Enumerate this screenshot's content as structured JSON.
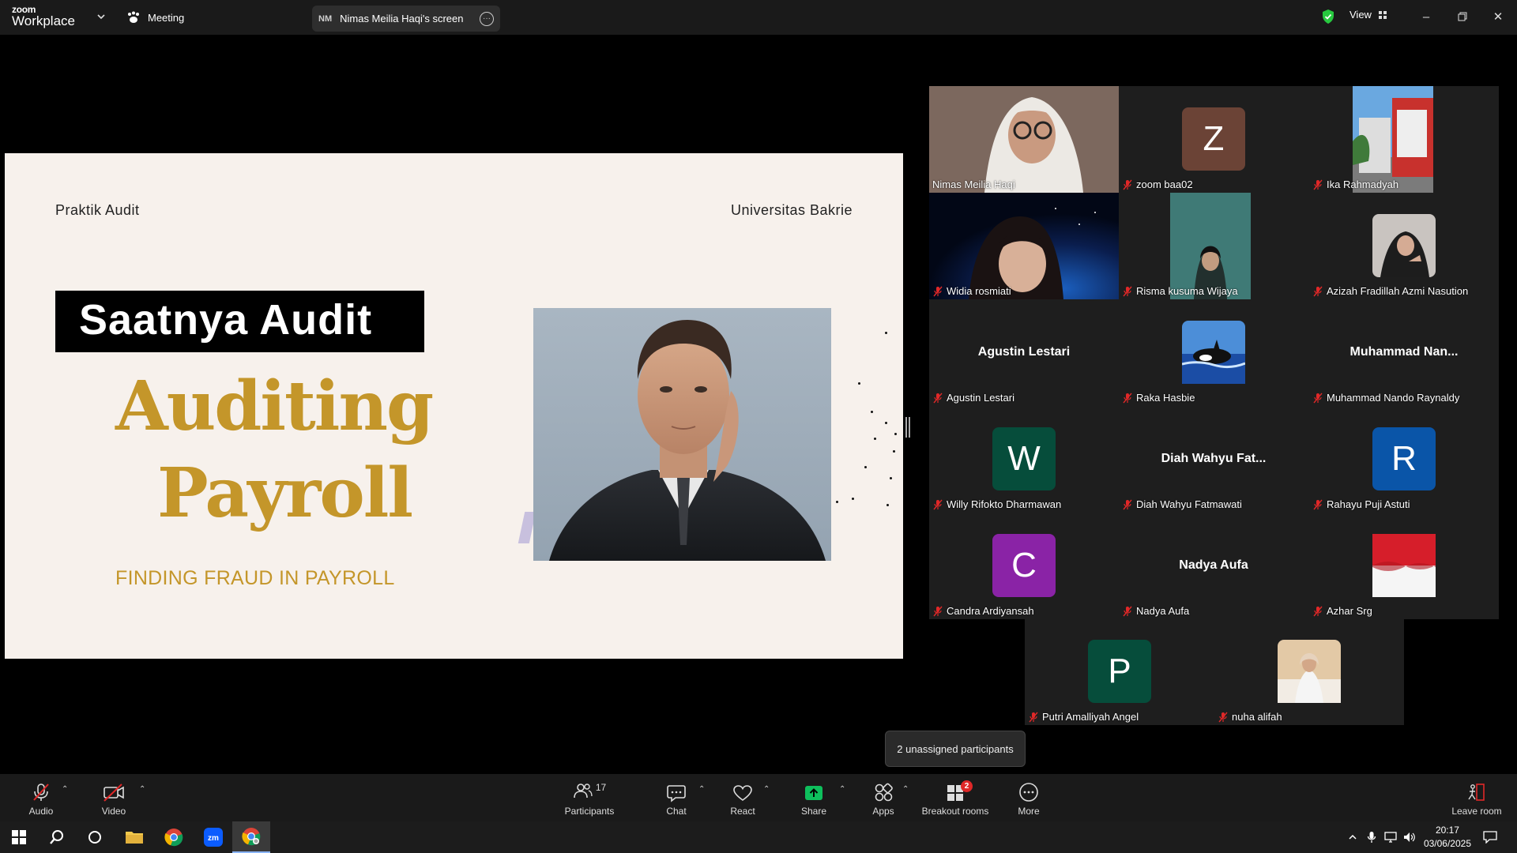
{
  "app": {
    "logo_top": "zoom",
    "logo_bottom": "Workplace",
    "meeting_label": "Meeting",
    "screen_initials": "NM",
    "screen_title": "Nimas Meilia Haqi's screen",
    "view_label": "View"
  },
  "slide": {
    "header_left": "Praktik Audit",
    "header_right": "Universitas Bakrie",
    "banner": "Saatnya Audit",
    "title_line1": "Auditing",
    "title_line2": "Payroll",
    "subtitle": "FINDING FRAUD IN PAYROLL"
  },
  "participants": [
    {
      "name": "Nimas Meilia Haqi",
      "display": "",
      "initial": "",
      "muted": false,
      "kind": "video-hijab",
      "active": true
    },
    {
      "name": "zoom baa02",
      "display": "",
      "initial": "Z",
      "color": "#6b4336",
      "muted": true,
      "kind": "avatar"
    },
    {
      "name": "Ika Rahmadyah",
      "display": "",
      "initial": "",
      "muted": true,
      "kind": "photo-building"
    },
    {
      "name": "Widia rosmiati",
      "display": "",
      "initial": "",
      "muted": true,
      "kind": "video-space"
    },
    {
      "name": "Risma kusuma Wijaya",
      "display": "",
      "initial": "",
      "muted": true,
      "kind": "photo-forest"
    },
    {
      "name": "Azizah Fradillah Azmi Nasution",
      "display": "",
      "initial": "",
      "muted": true,
      "kind": "photo-portrait"
    },
    {
      "name": "Agustin Lestari",
      "display": "Agustin Lestari",
      "initial": "",
      "muted": true,
      "kind": "text"
    },
    {
      "name": "Raka Hasbie",
      "display": "",
      "initial": "",
      "muted": true,
      "kind": "photo-orca"
    },
    {
      "name": "Muhammad Nando Raynaldy",
      "display": "Muhammad  Nan...",
      "initial": "",
      "muted": true,
      "kind": "text"
    },
    {
      "name": "Willy Rifokto Dharmawan",
      "display": "",
      "initial": "W",
      "color": "#064d3b",
      "muted": true,
      "kind": "avatar"
    },
    {
      "name": "Diah Wahyu Fatmawati",
      "display": "Diah Wahyu Fat...",
      "initial": "",
      "muted": true,
      "kind": "text"
    },
    {
      "name": "Rahayu Puji Astuti",
      "display": "",
      "initial": "R",
      "color": "#0a55a8",
      "muted": true,
      "kind": "avatar"
    },
    {
      "name": "Candra Ardiyansah",
      "display": "",
      "initial": "C",
      "color": "#8a23a6",
      "muted": true,
      "kind": "avatar"
    },
    {
      "name": "Nadya Aufa",
      "display": "Nadya Aufa",
      "initial": "",
      "muted": true,
      "kind": "text"
    },
    {
      "name": "Azhar Srg",
      "display": "",
      "initial": "",
      "muted": true,
      "kind": "photo-flag"
    },
    {
      "name": "Putri Amalliyah Angel",
      "display": "",
      "initial": "P",
      "color": "#064d3b",
      "muted": true,
      "kind": "avatar"
    },
    {
      "name": "nuha alifah",
      "display": "",
      "initial": "",
      "muted": true,
      "kind": "photo-room"
    }
  ],
  "tooltip": "2 unassigned participants",
  "toolbar": {
    "audio": "Audio",
    "video": "Video",
    "participants": "Participants",
    "participants_count": "17",
    "chat": "Chat",
    "react": "React",
    "share": "Share",
    "apps": "Apps",
    "breakout": "Breakout rooms",
    "breakout_badge": "2",
    "more": "More",
    "leave": "Leave room"
  },
  "taskbar": {
    "time": "20:17",
    "date": "03/06/2025"
  },
  "colors": {
    "accent_green": "#27c93f",
    "slide_gold": "#c4962a",
    "share_green": "#0ebf5c",
    "muted_red": "#e02828"
  }
}
